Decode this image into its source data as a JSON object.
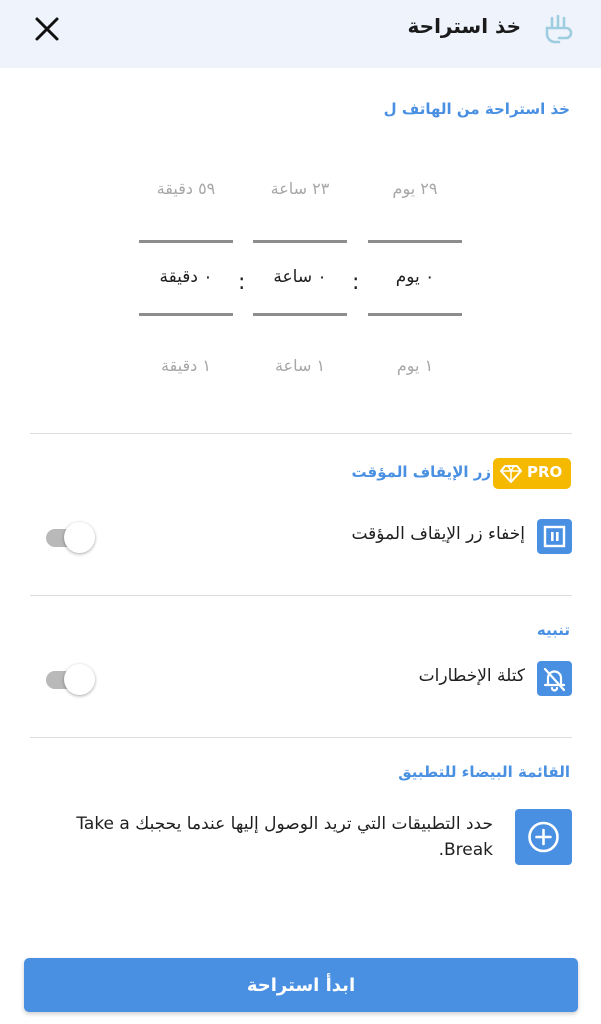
{
  "header": {
    "title": "خذ استراحة",
    "close_icon": "close-icon",
    "app_icon": "hand-icon"
  },
  "break_duration": {
    "section_title": "خذ استراحة من الهاتف ل",
    "days": {
      "above": "٢٩ يوم",
      "current": "٠ يوم",
      "below": "١ يوم"
    },
    "hours": {
      "above": "٢٣ ساعة",
      "current": "٠ ساعة",
      "below": "١ ساعة"
    },
    "minutes": {
      "above": "٥٩ دقيقة",
      "current": "٠ دقيقة",
      "below": "١ دقيقة"
    },
    "separator": ":"
  },
  "pause_section": {
    "title": "زر الإيقاف المؤقت",
    "badge": "PRO",
    "badge_color": "#f5b900",
    "row_label": "إخفاء زر الإيقاف المؤقت",
    "row_icon": "pause-icon",
    "toggle_on": false
  },
  "alert_section": {
    "title": "تنبيه",
    "row_label": "كتلة الإخطارات",
    "row_icon": "bell-off-icon",
    "toggle_on": false
  },
  "whitelist_section": {
    "title": "القائمة البيضاء للتطبيق",
    "description": "حدد التطبيقات التي تريد الوصول إليها عندما يحجبك Take a Break.",
    "add_icon": "add-circle-icon"
  },
  "start_button": {
    "label": "ابدأ استراحة"
  },
  "colors": {
    "accent": "#4a90e2",
    "header_bg": "#eef3fc",
    "pro_badge": "#f5b900",
    "toggle_off": "#b9b9b9"
  }
}
